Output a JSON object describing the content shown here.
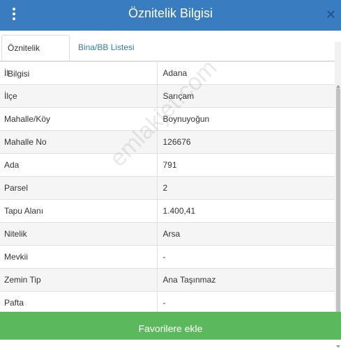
{
  "header": {
    "title": "Öznitelik Bilgisi",
    "close_glyph": "✕"
  },
  "tabs": [
    {
      "label": "Öznitelik Bilgisi",
      "active": true
    },
    {
      "label": "Bina/BB Listesi",
      "active": false
    }
  ],
  "attributes": [
    {
      "key": "İl",
      "value": "Adana"
    },
    {
      "key": "İlçe",
      "value": "Sarıçam"
    },
    {
      "key": "Mahalle/Köy",
      "value": "Boynuyoğun"
    },
    {
      "key": "Mahalle No",
      "value": "126676"
    },
    {
      "key": "Ada",
      "value": "791"
    },
    {
      "key": "Parsel",
      "value": "2"
    },
    {
      "key": "Tapu Alanı",
      "value": "1.400,41"
    },
    {
      "key": "Nitelik",
      "value": "Arsa"
    },
    {
      "key": "Mevkii",
      "value": "-"
    },
    {
      "key": "Zemin Tip",
      "value": "Ana Taşınmaz"
    },
    {
      "key": "Pafta",
      "value": "-"
    }
  ],
  "watermark": "emlakjet.com",
  "footer": {
    "favorites_label": "Favorilere ekle"
  },
  "colors": {
    "header": "#3a7cc0",
    "footer": "#5cb85c",
    "link": "#337ab7"
  }
}
